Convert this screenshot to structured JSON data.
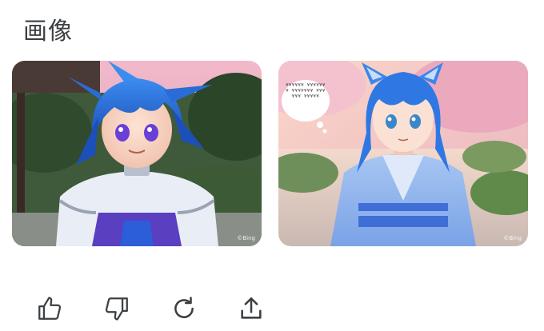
{
  "section": {
    "title": "画像"
  },
  "images": [
    {
      "alt": "Anime character with blue hair and violet eyes in a white outfit",
      "watermark": "©Bing"
    },
    {
      "alt": "Anime girl with blue hair and cat ears in a light blue kimono",
      "watermark": "©Bing",
      "bubble_text": "¥¥¥¥¥¥ ¥¥¥¥¥¥¥ ¥¥¥¥¥¥¥ ¥¥¥¥¥¥ ¥¥¥¥¥"
    }
  ],
  "actions": [
    {
      "name": "like",
      "icon": "thumbs-up-icon"
    },
    {
      "name": "dislike",
      "icon": "thumbs-down-icon"
    },
    {
      "name": "regenerate",
      "icon": "refresh-icon"
    },
    {
      "name": "share",
      "icon": "share-icon"
    }
  ],
  "colors": {
    "icon": "#3c4043",
    "title": "#3c4043",
    "hair": "#2a6cd6"
  }
}
